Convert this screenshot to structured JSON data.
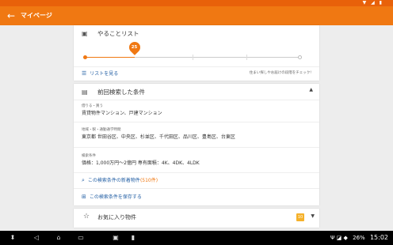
{
  "status_bar": {
    "icons": "▼ ◢ ▮"
  },
  "app_bar": {
    "back_icon": "←",
    "title": "マイページ"
  },
  "todo": {
    "title": "やることリスト",
    "progress_value": 25,
    "progress_fraction": 0.23,
    "link_label": "リストを見る",
    "hint": "住まい探しやお届けの段階をチェック!"
  },
  "search": {
    "title": "前回検索した条件",
    "sections": [
      {
        "label": "借りる・買う",
        "value": "賃貸物件マンション、戸建マンション"
      },
      {
        "label": "地域・駅・通勤通学時間",
        "value": "東京都 世田谷区、中央区、杉並区、千代田区、品川区、豊島区、台東区"
      },
      {
        "label": "検索条件",
        "value": "価格：1,000万円〜2億円 専有面積：4K、4DK、4LDK"
      }
    ],
    "new_listings_label": "この検索条件の新着物件",
    "new_listings_count": "(510件)",
    "save_label": "この検索条件を保存する"
  },
  "favorites": {
    "title": "お気に入り物件",
    "badge": "10"
  },
  "nav_bar": {
    "clock": "15:02",
    "battery": "26%",
    "indicators": "Ψ ◪ ◆"
  }
}
